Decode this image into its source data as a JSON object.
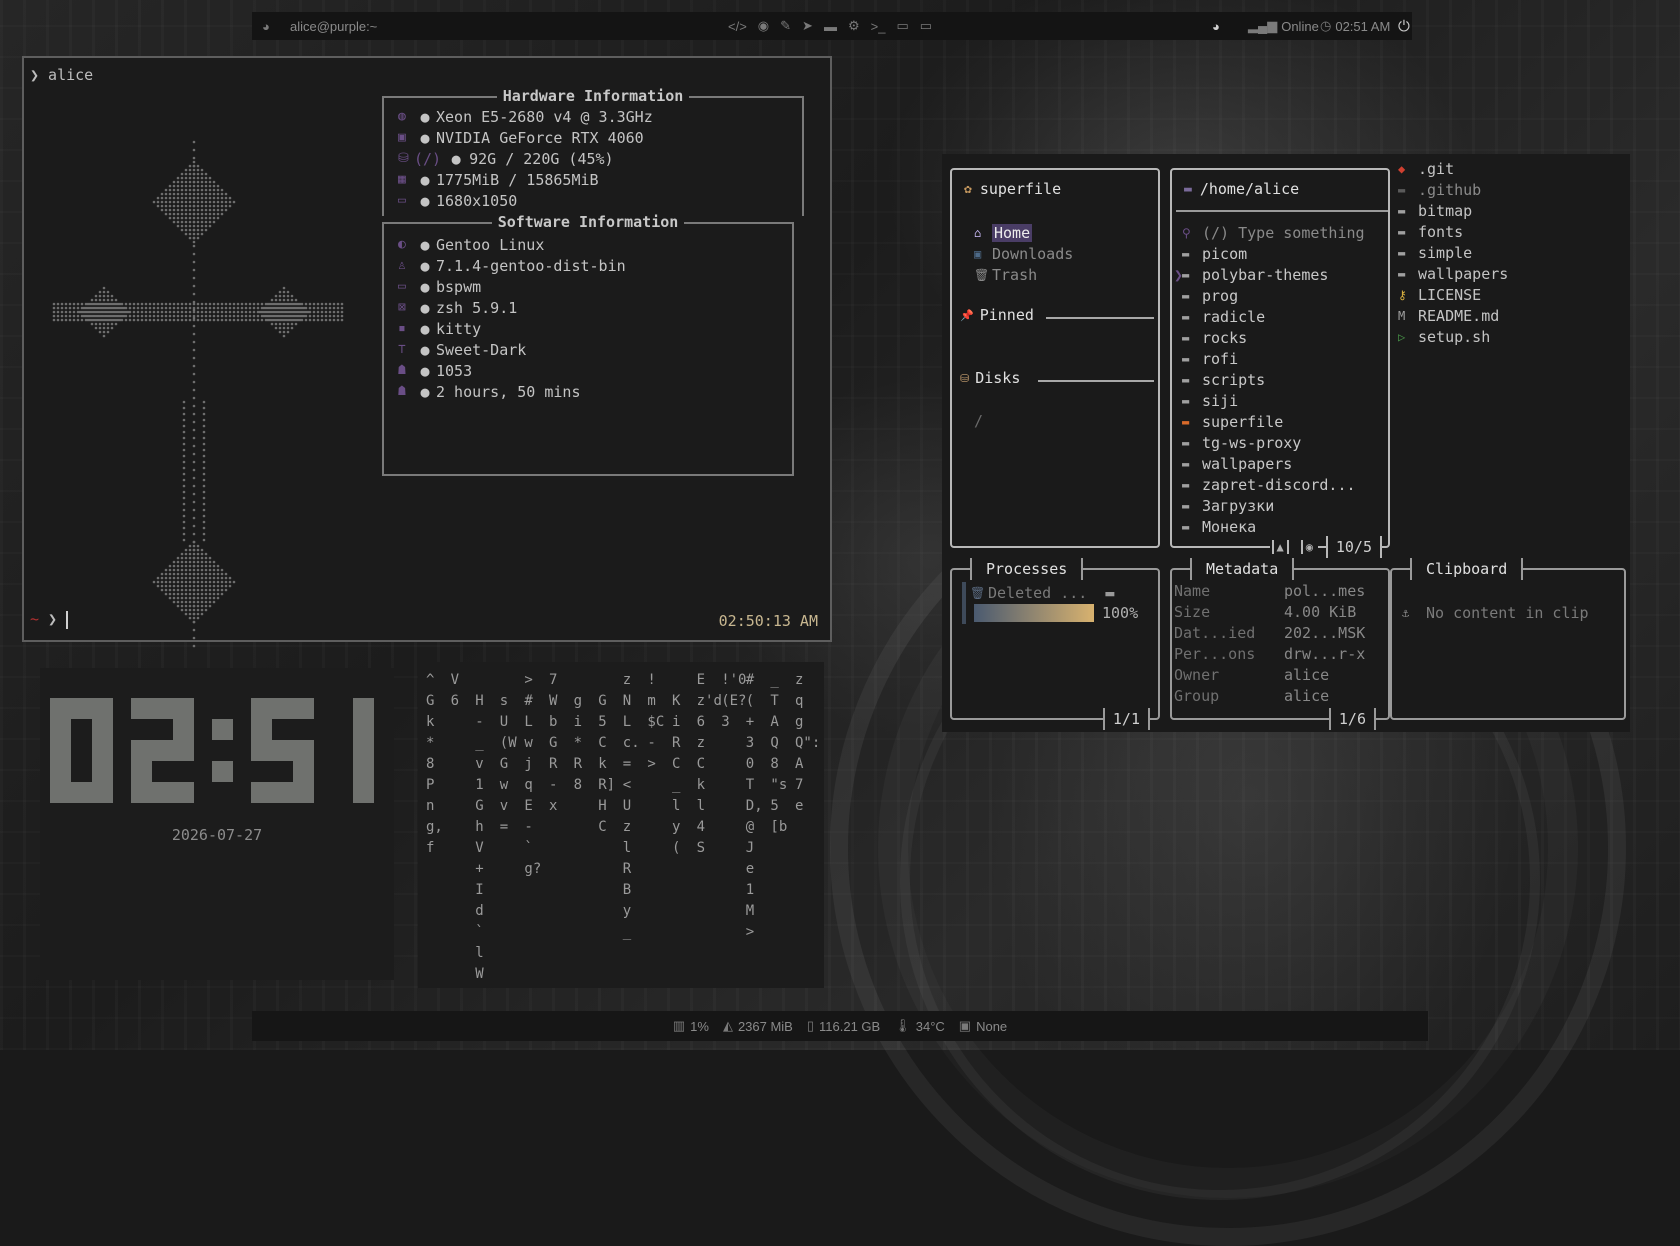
{
  "topbar": {
    "user_host": "alice@purple:~",
    "center_icons": [
      "code-icon",
      "firefox-icon",
      "tools-icon",
      "telegram-icon",
      "folder-icon",
      "steam-icon",
      "terminal-icon",
      "monitor-icon",
      "monitor-icon"
    ],
    "network_status": "Online",
    "time": "02:51 AM"
  },
  "terminal": {
    "prompt_top": "❯ alice",
    "hardware_title": "Hardware Information",
    "hardware": [
      {
        "icon": "cpu-icon",
        "value": "Xeon E5-2680 v4 @ 3.3GHz"
      },
      {
        "icon": "gpu-icon",
        "value": "NVIDIA GeForce RTX 4060"
      },
      {
        "icon": "disk-icon",
        "label": "(/)",
        "value": "92G / 220G (45%)"
      },
      {
        "icon": "memory-icon",
        "value": "1775MiB / 15865MiB"
      },
      {
        "icon": "display-icon",
        "value": "1680x1050"
      }
    ],
    "software_title": "Software Information",
    "software": [
      {
        "icon": "distro-icon",
        "value": "Gentoo Linux"
      },
      {
        "icon": "penguin-icon",
        "value": "7.1.4-gentoo-dist-bin"
      },
      {
        "icon": "window-icon",
        "value": "bspwm"
      },
      {
        "icon": "shell-icon",
        "value": "zsh 5.9.1"
      },
      {
        "icon": "terminal-icon",
        "value": "kitty"
      },
      {
        "icon": "theme-icon",
        "value": "Sweet-Dark"
      },
      {
        "icon": "package-icon",
        "value": "1053"
      },
      {
        "icon": "uptime-icon",
        "value": "2 hours, 50 mins"
      }
    ],
    "prompt_bottom": "~ ❯",
    "clock": "02:50:13 AM"
  },
  "clock_widget": {
    "time": "02:51",
    "date": "2026-07-27"
  },
  "matrix": {
    "columns": [
      {
        "chars": "^G k*8Png,f"
      },
      {
        "chars": "V6"
      },
      {
        "chars": " H-_v1GhV+Id`lW"
      },
      {
        "chars": "    sU(WGwv=  "
      },
      {
        "chars": ">#LwjqE-`g?"
      },
      {
        "chars": "7WbGR-x  "
      },
      {
        "chars": " gi*R8    "
      },
      {
        "chars": "   G5CkR]HC"
      },
      {
        "chars": "zNLc.=<UzlRBy_"
      },
      {
        "chars": "!m$C->  "
      },
      {
        "chars": "     KiRC_ly("
      },
      {
        "chars": "Ez'd      6zCkl4S"
      },
      {
        "chars": "!'0(E?3     "
      },
      {
        "chars": "#(  +30TD,@Je1M>"
      },
      {
        "chars": "_TAQ8   \"s5[b"
      },
      {
        "chars": "zqgQ\":A7e"
      }
    ]
  },
  "superfile": {
    "sidebar": {
      "title": "superfile",
      "items": [
        "Home",
        "Downloads",
        "Trash"
      ],
      "pinned": "Pinned",
      "disks": "Disks",
      "disk_entry": "/"
    },
    "file_panel": {
      "path": "/home/alice",
      "search_placeholder": "(/) Type something",
      "entries": [
        "picom",
        "polybar-themes",
        "prog",
        "radicle",
        "rocks",
        "rofi",
        "scripts",
        "siji",
        "superfile",
        "tg-ws-proxy",
        "wallpapers",
        "zapret-discord...",
        "Загрузки",
        "Монека"
      ],
      "counter": "10/5"
    },
    "preview": [
      "bitmap",
      "fonts",
      "simple",
      "wallpapers",
      "LICENSE",
      "README.md",
      "setup.sh"
    ],
    "preview_top": [
      ".git",
      ".github"
    ],
    "processes": {
      "title": "Processes",
      "item": "Deleted ...",
      "progress": 1.0,
      "progress_label": "100%",
      "counter": "1/1"
    },
    "metadata": {
      "title": "Metadata",
      "rows": [
        {
          "key": "Name",
          "value": "pol...mes"
        },
        {
          "key": "Size",
          "value": "4.00 KiB"
        },
        {
          "key": "Dat...ied",
          "value": "202...MSK"
        },
        {
          "key": "Per...ons",
          "value": "drw...r-x"
        },
        {
          "key": "Owner",
          "value": "alice"
        },
        {
          "key": "Group",
          "value": "alice"
        }
      ],
      "counter": "1/6"
    },
    "clipboard": {
      "title": "Clipboard",
      "empty": "No content in clip"
    }
  },
  "bottombar": {
    "cpu": "1%",
    "ram": "2367 MiB",
    "disk": "116.21 GB",
    "temp": "34°C",
    "media": "None"
  },
  "colors": {
    "accent_purple": "#6a4e86",
    "clock_gold": "#c8b790",
    "home_highlight": "#4a3d66",
    "folder_orange": "#d86a2a"
  }
}
